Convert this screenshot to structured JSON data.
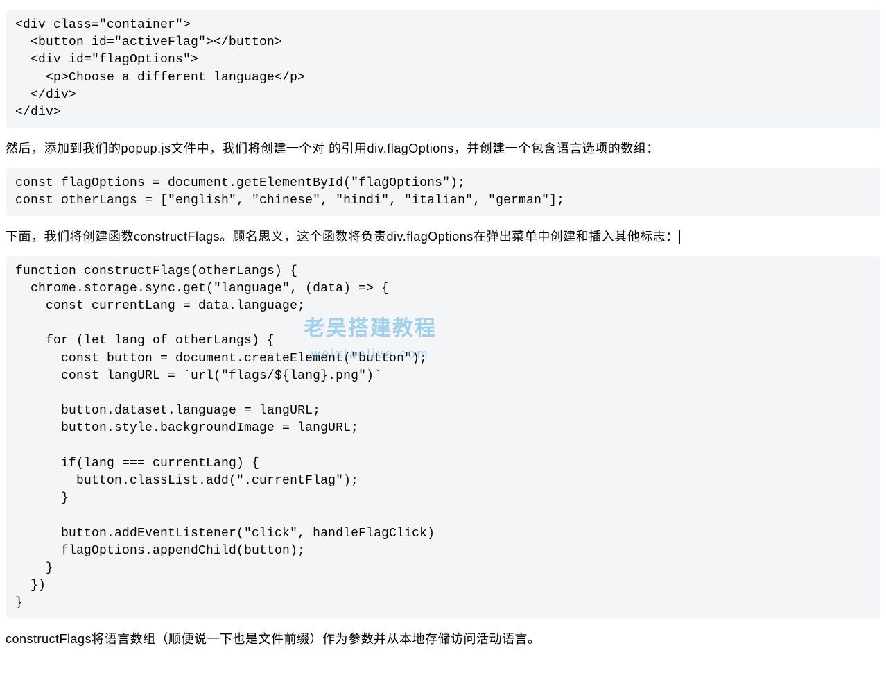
{
  "code1": "<div class=\"container\">\n  <button id=\"activeFlag\"></button>\n  <div id=\"flagOptions\">\n    <p>Choose a different language</p>\n  </div>\n</div>",
  "paragraph1": "然后，添加到我们的popup.js文件中，我们将创建一个对 的引用div.flagOptions，并创建一个包含语言选项的数组：",
  "code2": "const flagOptions = document.getElementById(\"flagOptions\");\nconst otherLangs = [\"english\", \"chinese\", \"hindi\", \"italian\", \"german\"];",
  "paragraph2": "下面，我们将创建函数constructFlags。顾名思义，这个函数将负责div.flagOptions在弹出菜单中创建和插入其他标志：",
  "code3": "function constructFlags(otherLangs) {\n  chrome.storage.sync.get(\"language\", (data) => {\n    const currentLang = data.language;\n\n    for (let lang of otherLangs) {\n      const button = document.createElement(\"button\");\n      const langURL = `url(\"flags/${lang}.png\")`\n\n      button.dataset.language = langURL;\n      button.style.backgroundImage = langURL;\n\n      if(lang === currentLang) {\n        button.classList.add(\".currentFlag\");\n      }\n\n      button.addEventListener(\"click\", handleFlagClick)\n      flagOptions.appendChild(button);\n    }\n  })\n}",
  "paragraph3": "constructFlags将语言数组（顺便说一下也是文件前缀）作为参数并从本地存储访问活动语言。",
  "watermark": {
    "main": "老吴搭建教程",
    "sub": "weixiaolive.com"
  }
}
